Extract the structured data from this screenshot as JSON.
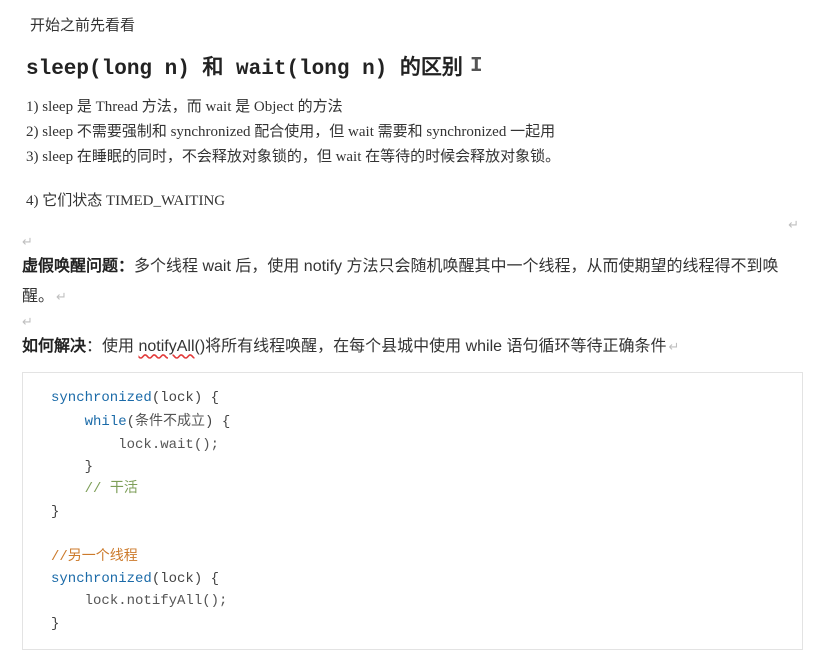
{
  "intro": "开始之前先看看",
  "heading": {
    "mono1": "sleep(long n)",
    "mid": " 和 ",
    "mono2": "wait(long n)",
    "tail": " 的区别"
  },
  "caret": "I",
  "points": {
    "p1": "1) sleep 是 Thread 方法，而 wait 是 Object 的方法",
    "p2": "2) sleep 不需要强制和 synchronized 配合使用，但 wait 需要和 synchronized 一起用",
    "p3": "3) sleep 在睡眠的同时，不会释放对象锁的，但 wait 在等待的时候会释放对象锁。",
    "p4": "4) 它们状态 TIMED_WAITING"
  },
  "para_mark": "↵",
  "spurious": {
    "bold": "虚假唤醒问题：",
    "rest": "多个线程 wait 后，使用 notify 方法只会随机唤醒其中一个线程，从而使期望的线程得不到唤醒。"
  },
  "howto": {
    "bold": "如何解决",
    "colon": "：使用 ",
    "sq": "notifyAll",
    "rest": "()将所有线程唤醒，在每个县城中使用 while 语句循环等待正确条件"
  },
  "code": {
    "l1_kw": "synchronized",
    "l1_rest": "(lock) {",
    "l2_kw": "while",
    "l2_rest": "(条件不成立) {",
    "l3": "lock.wait();",
    "l4": "}",
    "l5_c": "// 干活",
    "l6": "}",
    "l7": "",
    "l8_c": "//另一个线程",
    "l9_kw": "synchronized",
    "l9_rest": "(lock) {",
    "l10": "lock.notifyAll();",
    "l11": "}"
  }
}
